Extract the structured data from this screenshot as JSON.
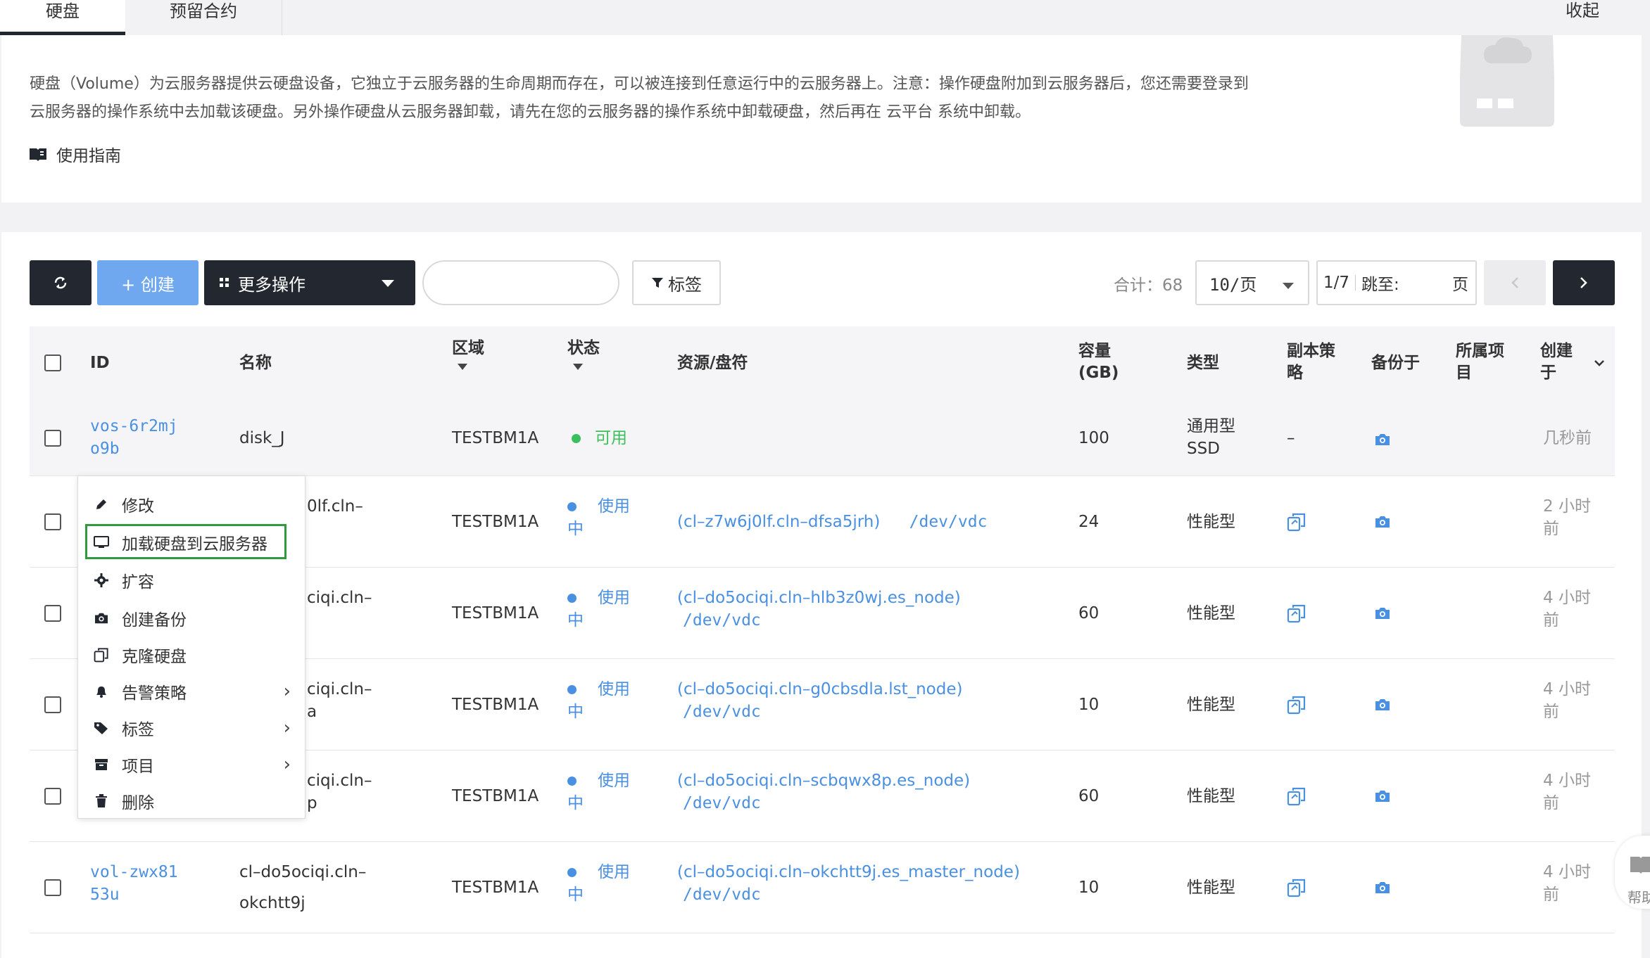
{
  "tabs": [
    {
      "label": "硬盘"
    },
    {
      "label": "预留合约"
    }
  ],
  "collapse_label": "收起",
  "intro": {
    "line1": "硬盘（Volume）为云服务器提供云硬盘设备，它独立于云服务器的生命周期而存在，可以被连接到任意运行中的云服务器上。注意：操作硬盘附加到云服务器后，您还需要登录到",
    "line2": "云服务器的操作系统中去加载该硬盘。另外操作硬盘从云服务器卸载，请先在您的云服务器的操作系统中卸载硬盘，然后再在 云平台 系统中卸载。",
    "guide": "使用指南"
  },
  "toolbar": {
    "create": "+ 创建",
    "more": "更多操作",
    "search_placeholder": "",
    "tag": "标签",
    "total": "合计：68",
    "page_size": "10/页",
    "page": "1/7",
    "jump_label": "跳至:",
    "jump_unit": "页"
  },
  "table": {
    "headers": {
      "id": "ID",
      "name": "名称",
      "region": "区域",
      "status": "状态",
      "resource": "资源/盘符",
      "capacity_l1": "容量",
      "capacity_l2": "(GB)",
      "type": "类型",
      "replica_l1": "副本策",
      "replica_l2": "略",
      "backup": "备份于",
      "project_l1": "所属项",
      "project_l2": "目",
      "created_l1": "创建",
      "created_l2": "于"
    },
    "rows": [
      {
        "id_l1": "vos-6r2mj",
        "id_l2": "o9b",
        "name_l1": "disk_J",
        "name_l2": "",
        "region": "TESTBM1A",
        "status": "可用",
        "status_l2": "",
        "resource": "",
        "dev": "",
        "capacity": "100",
        "type_l1": "通用型",
        "type_l2": "SSD",
        "replica": "–",
        "created_l1": "几秒前",
        "created_l2": ""
      },
      {
        "id_l1": "",
        "id_l2": "",
        "name_l1": "0lf.cln–",
        "name_l2": "",
        "region": "TESTBM1A",
        "status": "使用",
        "status_l2": "中",
        "resource": "(cl–z7w6j0lf.cln–dfsa5jrh)",
        "dev": "/dev/vdc",
        "capacity": "24",
        "type_l1": "性能型",
        "type_l2": "",
        "replica": "",
        "created_l1": "2 小时",
        "created_l2": "前"
      },
      {
        "id_l1": "",
        "id_l2": "",
        "name_l1": "ciqi.cln–",
        "name_l2": "",
        "region": "TESTBM1A",
        "status": "使用",
        "status_l2": "中",
        "resource": "(cl–do5ociqi.cln–hlb3z0wj.es_node)",
        "dev": "/dev/vdc",
        "capacity": "60",
        "type_l1": "性能型",
        "type_l2": "",
        "replica": "",
        "created_l1": "4 小时",
        "created_l2": "前"
      },
      {
        "id_l1": "",
        "id_l2": "",
        "name_l1": "ciqi.cln–",
        "name_l2": "a",
        "region": "TESTBM1A",
        "status": "使用",
        "status_l2": "中",
        "resource": "(cl–do5ociqi.cln–g0cbsdla.lst_node)",
        "dev": "/dev/vdc",
        "capacity": "10",
        "type_l1": "性能型",
        "type_l2": "",
        "replica": "",
        "created_l1": "4 小时",
        "created_l2": "前"
      },
      {
        "id_l1": "",
        "id_l2": "",
        "name_l1": "ciqi.cln–",
        "name_l2": "p",
        "region": "TESTBM1A",
        "status": "使用",
        "status_l2": "中",
        "resource": "(cl–do5ociqi.cln–scbqwx8p.es_node)",
        "dev": "/dev/vdc",
        "capacity": "60",
        "type_l1": "性能型",
        "type_l2": "",
        "replica": "",
        "created_l1": "4 小时",
        "created_l2": "前"
      },
      {
        "id_l1": "vol-zwx81",
        "id_l2": "53u",
        "name_l1": "cl–do5ociqi.cln–",
        "name_l2": "okchtt9j",
        "region": "TESTBM1A",
        "status": "使用",
        "status_l2": "中",
        "resource": "(cl–do5ociqi.cln–okchtt9j.es_master_node)",
        "dev": "/dev/vdc",
        "capacity": "10",
        "type_l1": "性能型",
        "type_l2": "",
        "replica": "",
        "created_l1": "4 小时",
        "created_l2": "前"
      }
    ]
  },
  "menu": {
    "items": [
      {
        "label": "修改"
      },
      {
        "label": "加载硬盘到云服务器"
      },
      {
        "label": "扩容"
      },
      {
        "label": "创建备份"
      },
      {
        "label": "克隆硬盘"
      },
      {
        "label": "告警策略"
      },
      {
        "label": "标签"
      },
      {
        "label": "项目"
      },
      {
        "label": "删除"
      }
    ]
  },
  "help_label": "帮助",
  "colors": {
    "accent": "#4a90e2",
    "dark": "#23272f",
    "ok": "#3bbf5c",
    "highlight": "#2e9c3e"
  }
}
